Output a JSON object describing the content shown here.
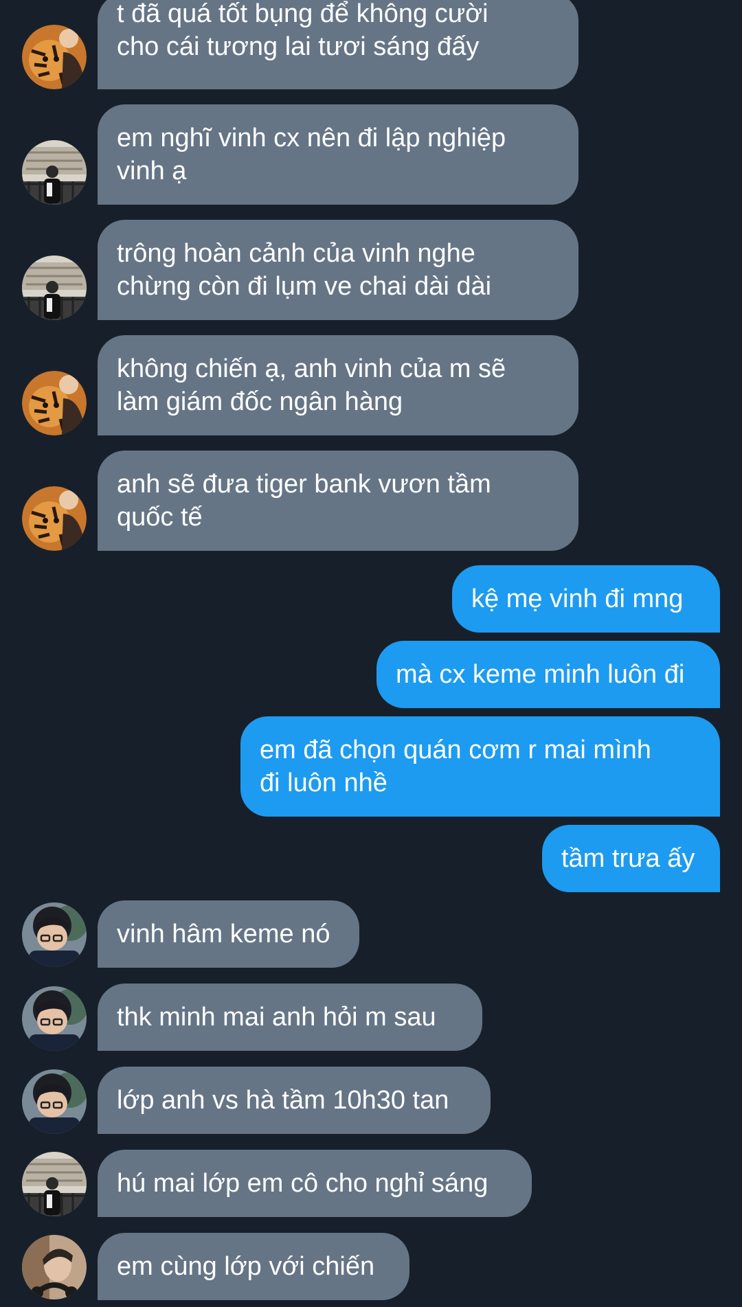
{
  "messages": [
    {
      "sender": "in",
      "avatar": "tiger-avatar",
      "text": "t đã quá tốt bụng để không cười\ncho cái tương lai tươi sáng đấy"
    },
    {
      "sender": "in",
      "avatar": "street-avatar",
      "text": "em nghĩ vinh cx nên đi lập nghiệp\nvinh ạ"
    },
    {
      "sender": "in",
      "avatar": "street-avatar",
      "text": "trông hoàn cảnh của vinh nghe\nchừng còn đi lụm ve chai dài dài"
    },
    {
      "sender": "in",
      "avatar": "tiger-avatar",
      "text": "không chiến ạ, anh vinh của m sẽ\nlàm giám đốc ngân hàng"
    },
    {
      "sender": "in",
      "avatar": "tiger-avatar",
      "text": "anh sẽ đưa tiger bank vươn tầm\nquốc tế"
    },
    {
      "sender": "out",
      "text": "kệ mẹ vinh đi mng"
    },
    {
      "sender": "out",
      "text": "mà cx keme minh luôn đi"
    },
    {
      "sender": "out",
      "text": "em đã chọn quán cơm r mai mình\nđi luôn nhề"
    },
    {
      "sender": "out",
      "text": "tầm trưa ấy"
    },
    {
      "sender": "in",
      "avatar": "glasses-avatar",
      "text": "vinh hâm keme nó"
    },
    {
      "sender": "in",
      "avatar": "glasses-avatar",
      "text": "thk minh mai anh hỏi m sau"
    },
    {
      "sender": "in",
      "avatar": "glasses-avatar",
      "text": "lớp anh vs hà tầm 10h30 tan"
    },
    {
      "sender": "in",
      "avatar": "street-avatar",
      "text": "hú mai lớp em cô cho nghỉ sáng"
    },
    {
      "sender": "in",
      "avatar": "headphones-avatar",
      "text": "em cùng lớp với chiến"
    }
  ],
  "colors": {
    "background": "#17202a",
    "incoming_bubble": "#657586",
    "outgoing_bubble": "#1d9bf0",
    "text": "#ffffff"
  }
}
